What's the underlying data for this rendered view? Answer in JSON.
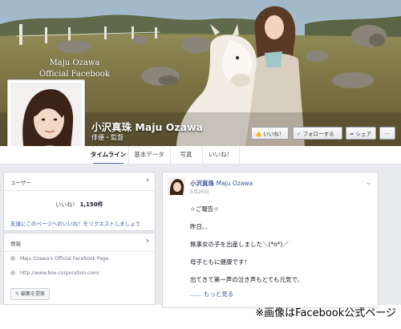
{
  "cover": {
    "caption_line1": "Maju Ozawa",
    "caption_line2": "Official Facebook"
  },
  "page": {
    "name": "小沢真珠 Maju Ozawa",
    "category": "俳優・監督"
  },
  "actions": {
    "like": "いいね！",
    "follow": "フォローする",
    "share": "シェア"
  },
  "tabs": [
    "タイムライン",
    "基本データ",
    "写真",
    "いいね！"
  ],
  "users_card": {
    "title": "ユーザー",
    "likes_label": "いいね！",
    "likes_count": "1,150件",
    "invite": "友達にこのページへのいいね！をリクエストしましょう"
  },
  "info_card": {
    "title": "情報",
    "about": "Maju Ozawa's Official Facebook Page.",
    "website": "http://www.box-corporation.com/",
    "edit": "編集を提案"
  },
  "post": {
    "author": "小沢真珠",
    "author_en": "Maju Ozawa",
    "date": "5月20日",
    "lines": [
      "☆ご報告☆",
      "昨日、、",
      "無事女の子を出産しました＼(*o*)／",
      "母子ともに健康です！",
      "出てきて第一声の泣き声もとても元気で、"
    ],
    "more": "...... もっと見る"
  },
  "credit": "※画像はFacebook公式ページ",
  "colors": {
    "fb_blue": "#3b5998",
    "background_gray": "#e9eaed"
  }
}
